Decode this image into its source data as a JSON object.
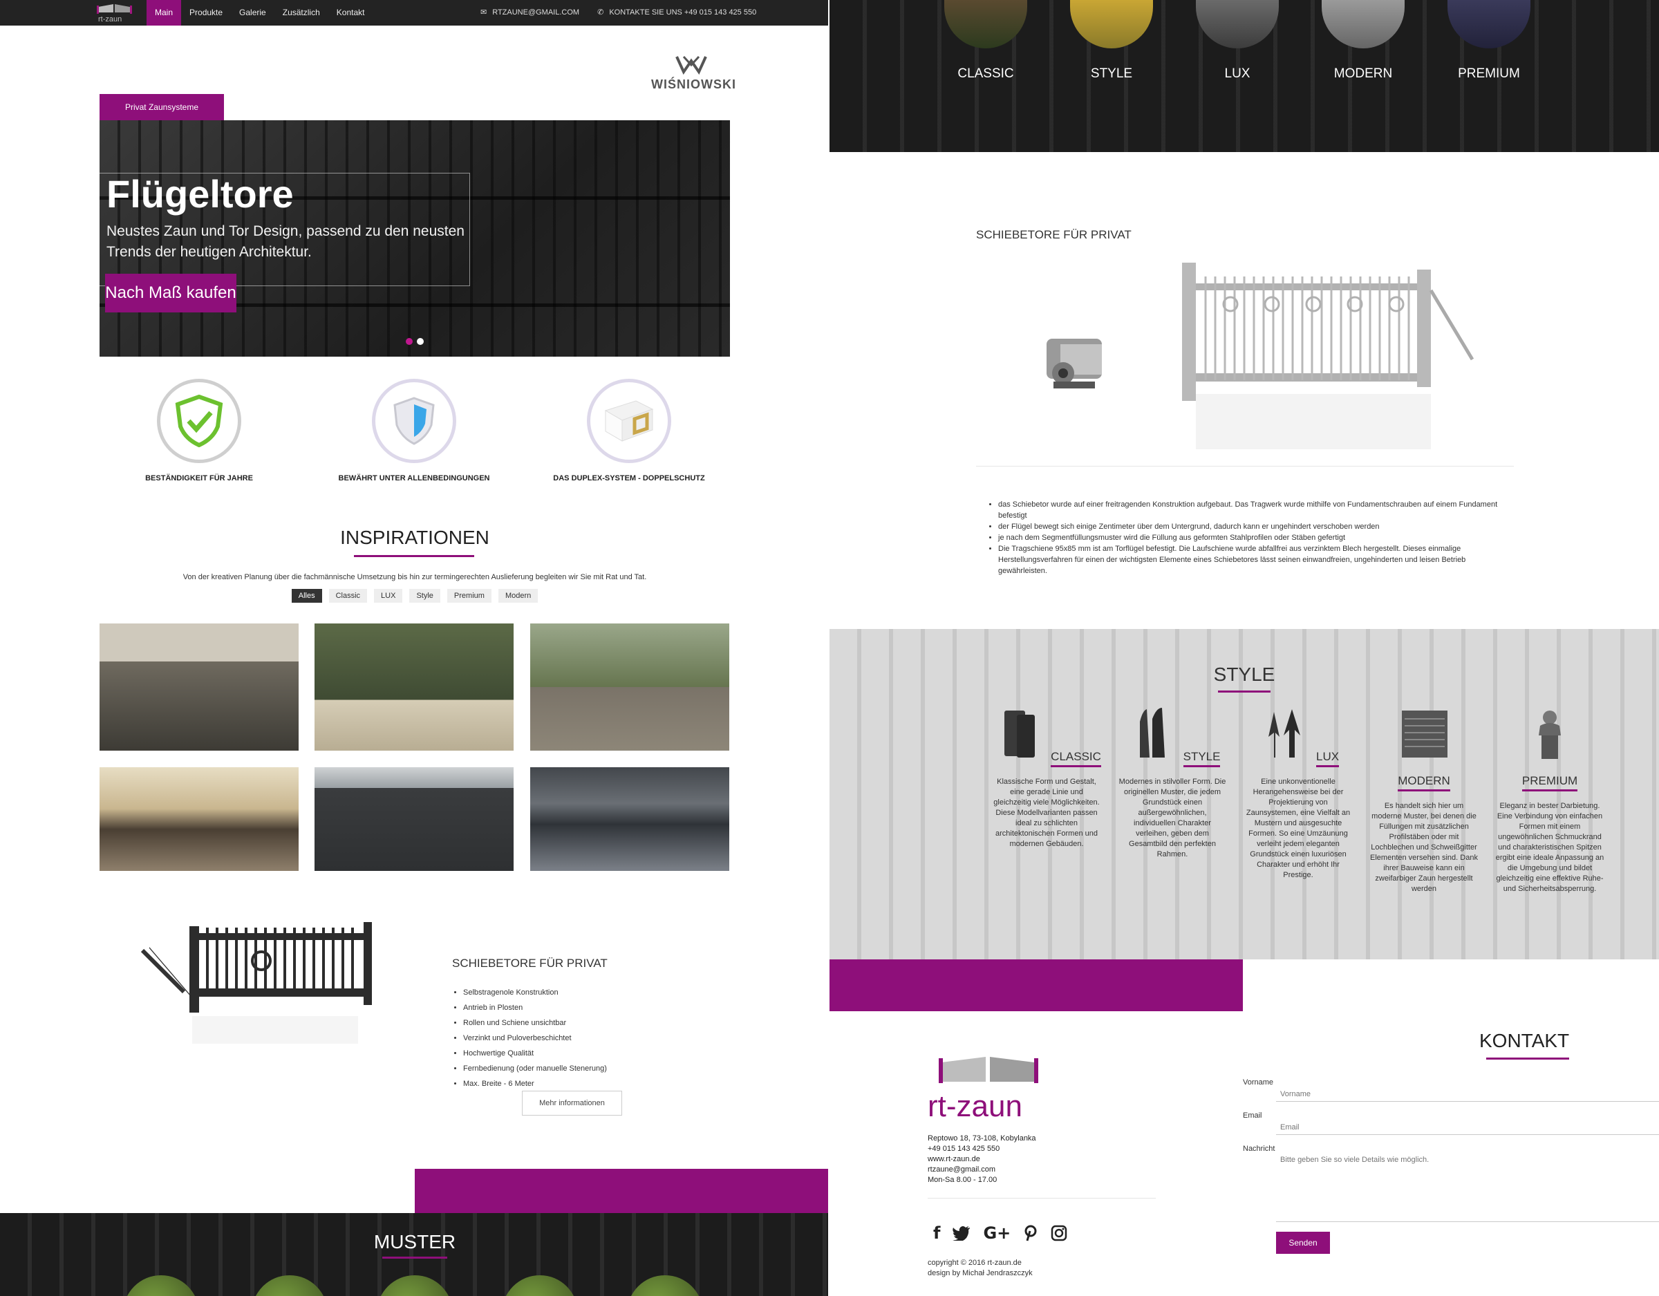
{
  "nav": {
    "items": [
      "Main",
      "Produkte",
      "Galerie",
      "Zusätzlich",
      "Kontakt"
    ],
    "active": "Main",
    "email": "RTZAUNE@GMAIL.COM",
    "phone": "KONTAKTE SIE UNS +49 015 143 425 550"
  },
  "brand": {
    "partner": "WIŚNIOWSKI",
    "logo_text": "rt-zaun"
  },
  "hero": {
    "tab": "Privat Zaunsysteme",
    "title": "Flügeltore",
    "subtitle": "Neustes Zaun und Tor Design, passend zu den neusten Trends der heutigen Architektur.",
    "button": "Nach Maß kaufen"
  },
  "features": [
    {
      "label": "BESTÄNDIGKEIT FÜR JAHRE",
      "icon": "green-shield-check-icon"
    },
    {
      "label": "BEWÄHRT UNTER ALLENBEDINGUNGEN",
      "icon": "blue-shield-icon"
    },
    {
      "label": "DAS DUPLEX-SYSTEM - DOPPELSCHUTZ",
      "icon": "duplex-profile-icon"
    }
  ],
  "inspirationen": {
    "title": "INSPIRATIONEN",
    "subtitle": "Von der kreativen Planung über die fachmännische Umsetzung bis hin zur termingerechten Auslieferung begleiten wir Sie mit Rat und Tat.",
    "filters": [
      "Alles",
      "Classic",
      "LUX",
      "Style",
      "Premium",
      "Modern"
    ],
    "active_filter": "Alles"
  },
  "schiebetore_left": {
    "title": "SCHIEBETORE FÜR PRIVAT",
    "items": [
      "Selbstragenole Konstruktion",
      "Antrieb in Plosten",
      "Rollen und Schiene unsichtbar",
      "Verzinkt und Puloverbeschichtet",
      "Hochwertige Qualität",
      "Fernbedienung (oder manuelle Stenerung)",
      "Max. Breite - 6 Meter"
    ],
    "button": "Mehr informationen"
  },
  "muster": {
    "title": "MUSTER"
  },
  "categories": [
    "CLASSIC",
    "STYLE",
    "LUX",
    "MODERN",
    "PREMIUM"
  ],
  "schiebetore_right": {
    "title": "SCHIEBETORE FÜR PRIVAT",
    "items": [
      "das Schiebetor wurde auf einer freitragenden Konstruktion aufgebaut. Das Tragwerk wurde mithilfe von Fundamentschrauben auf einem Fundament befestigt",
      "der Flügel bewegt sich einige Zentimeter über dem Untergrund, dadurch kann er ungehindert verschoben werden",
      "je nach dem Segmentfüllungsmuster wird die Füllung aus geformten Stahlprofilen oder Stäben gefertigt",
      "Die Tragschiene 95x85 mm ist am Torflügel befestigt. Die Laufschiene wurde abfallfrei aus verzinktem Blech hergestellt. Dieses einmalige Herstellungsverfahren für einen der wichtigsten Elemente eines Schiebetores lässt seinen einwandfreien, ungehinderten und leisen Betrieb gewährleisten."
    ]
  },
  "style": {
    "title": "STYLE",
    "columns": [
      {
        "name": "CLASSIC",
        "desc": "Klassische Form und Gestalt, eine gerade Linie und gleichzeitig viele Möglichkeiten. Diese Modellvarianten passen ideal zu schlichten architektonischen Formen und modernen Gebäuden."
      },
      {
        "name": "STYLE",
        "desc": "Modernes in stilvoller Form. Die originellen Muster, die jedem Grundstück einen außergewöhnlichen, individuellen Charakter verleihen, geben dem Gesamtbild den perfekten Rahmen."
      },
      {
        "name": "LUX",
        "desc": "Eine unkonventionelle Herangehensweise bei der Projektierung von Zaunsystemen, eine Vielfalt an Mustern und ausgesuchte Formen. So eine Umzäunung verleiht jedem eleganten Grundstück einen luxuriösen Charakter und erhöht Ihr Prestige."
      },
      {
        "name": "MODERN",
        "desc": "Es handelt sich hier um moderne Muster, bei denen die Füllungen mit zusätzlichen Profilstäben oder mit Lochblechen und Schweißgitter Elementen versehen sind. Dank ihrer Bauweise kann ein zweifarbiger Zaun hergestellt werden"
      },
      {
        "name": "PREMIUM",
        "desc": "Eleganz in bester Darbietung. Eine Verbindung von einfachen Formen mit einem ungewöhnlichen Schmuckrand und charakteristischen Spitzen ergibt eine ideale Anpassung an die Umgebung und bildet gleichzeitig eine effektive Ruhe- und Sicherheitsabsperrung."
      }
    ]
  },
  "footer": {
    "address": [
      "Reptowo 18, 73-108, Kobylanka",
      "+49 015 143 425 550",
      "www.rt-zaun.de",
      "rtzaune@gmail.com",
      "Mon-Sa 8.00 - 17.00"
    ],
    "copyright": "copyright © 2016 rt-zaun.de",
    "design": "design by Michał Jendraszczyk",
    "socials": [
      "facebook-icon",
      "twitter-icon",
      "google-plus-icon",
      "pinterest-icon",
      "instagram-icon"
    ]
  },
  "kontakt": {
    "title": "KONTAKT",
    "vorname_label": "Vorname",
    "vorname_placeholder": "Vorname",
    "email_label": "Email",
    "email_placeholder": "Email",
    "nachricht_label": "Nachricht",
    "nachricht_placeholder": "Bitte geben Sie so viele Details wie möglich.",
    "send": "Senden"
  },
  "colors": {
    "accent": "#8e0f7a",
    "topbar": "#232323",
    "dark_section": "#1c1c1c"
  }
}
